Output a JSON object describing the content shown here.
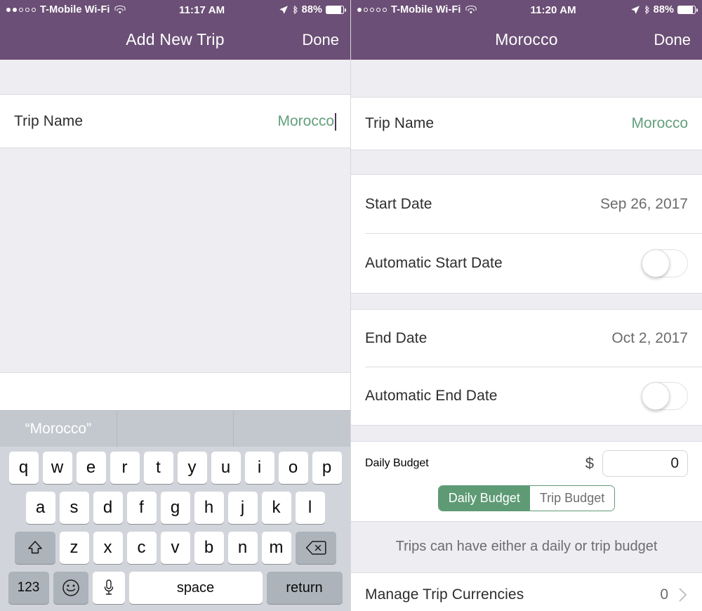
{
  "theme": {
    "header_purple": "#6b4f76",
    "accent_green": "#5e9b75",
    "value_green": "#63a07c",
    "group_gray": "#eeedf2",
    "keyboard_gray": "#d1d5db"
  },
  "left": {
    "status": {
      "carrier": "T-Mobile Wi-Fi",
      "time": "11:17 AM",
      "battery_pct": "88%",
      "signal_dots_filled": 2,
      "signal_dots_total": 5,
      "wifi_icon": "wifi-icon",
      "location_icon": "location-arrow-icon",
      "bluetooth_icon": "bluetooth-icon",
      "battery_icon": "battery-icon"
    },
    "nav": {
      "title": "Add New Trip",
      "done": "Done"
    },
    "trip_name": {
      "label": "Trip Name",
      "value": "Morocco"
    },
    "keyboard": {
      "suggestions": [
        "“Morocco”",
        "",
        ""
      ],
      "row1": [
        "q",
        "w",
        "e",
        "r",
        "t",
        "y",
        "u",
        "i",
        "o",
        "p"
      ],
      "row2": [
        "a",
        "s",
        "d",
        "f",
        "g",
        "h",
        "j",
        "k",
        "l"
      ],
      "row3": [
        "z",
        "x",
        "c",
        "v",
        "b",
        "n",
        "m"
      ],
      "shift_icon": "shift-up-arrow-icon",
      "backspace_icon": "backspace-delete-icon",
      "numbers_key": "123",
      "emoji_icon": "smiley-emoji-icon",
      "mic_icon": "microphone-icon",
      "space_key": "space",
      "return_key": "return"
    }
  },
  "right": {
    "status": {
      "carrier": "T-Mobile Wi-Fi",
      "time": "11:20 AM",
      "battery_pct": "88%",
      "signal_dots_filled": 1,
      "signal_dots_total": 5,
      "wifi_icon": "wifi-icon",
      "location_icon": "location-arrow-icon",
      "bluetooth_icon": "bluetooth-icon",
      "battery_icon": "battery-icon"
    },
    "nav": {
      "title": "Morocco",
      "done": "Done"
    },
    "rows": {
      "trip_name": {
        "label": "Trip Name",
        "value": "Morocco"
      },
      "start_date": {
        "label": "Start Date",
        "value": "Sep 26, 2017"
      },
      "automatic_start_date": {
        "label": "Automatic Start Date",
        "toggle": "off"
      },
      "end_date": {
        "label": "End Date",
        "value": "Oct 2, 2017"
      },
      "automatic_end_date": {
        "label": "Automatic End Date",
        "toggle": "off"
      },
      "daily_budget": {
        "label": "Daily Budget",
        "currency_symbol": "$",
        "amount": "0",
        "segments": [
          {
            "label": "Daily Budget",
            "selected": true
          },
          {
            "label": "Trip Budget",
            "selected": false
          }
        ],
        "footnote": "Trips can have either a daily or trip budget"
      },
      "manage_currencies": {
        "label": "Manage Trip Currencies",
        "value": "0",
        "chevron_icon": "chevron-right-icon"
      }
    }
  }
}
